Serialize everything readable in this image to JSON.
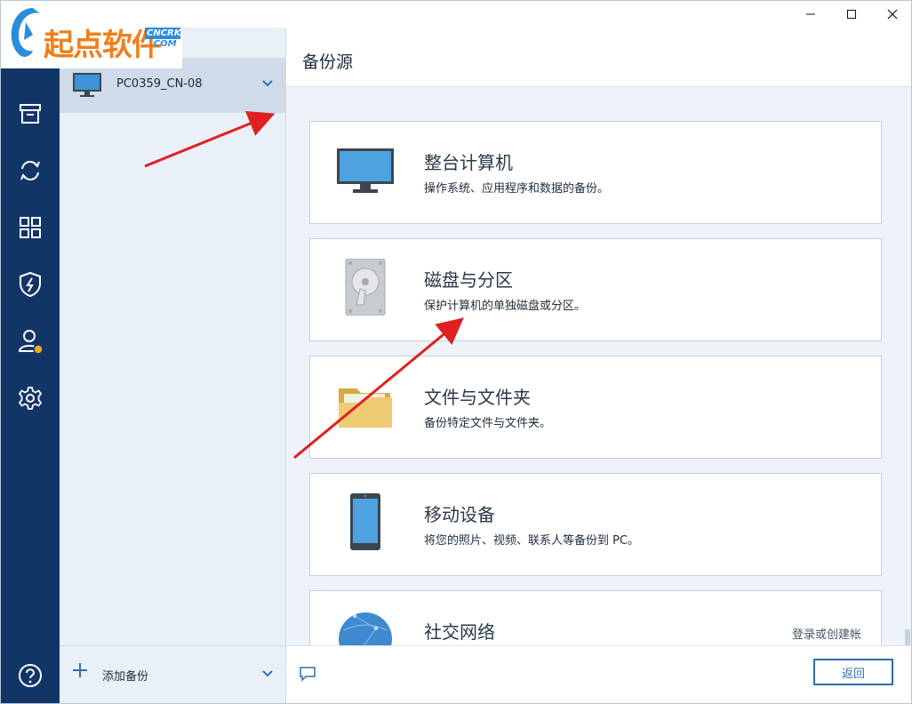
{
  "watermark": {
    "main_text": "起点软件",
    "tag_top": "CNCRK",
    "tag_bottom": ".COM"
  },
  "window_controls": [
    "minimize",
    "maximize",
    "close"
  ],
  "nav": {
    "icons": [
      "archive-icon",
      "sync-icon",
      "dashboard-icon",
      "shield-icon",
      "account-icon",
      "settings-icon",
      "help-icon"
    ],
    "notification_color": "#f6a623"
  },
  "backups": {
    "selected": {
      "name": "PC0359_CN-08"
    },
    "add_label": "添加备份"
  },
  "main": {
    "title": "备份源",
    "sources": [
      {
        "title": "整台计算机",
        "desc": "操作系统、应用程序和数据的备份。",
        "icon": "monitor-icon"
      },
      {
        "title": "磁盘与分区",
        "desc": "保护计算机的单独磁盘或分区。",
        "icon": "hard-disk-icon"
      },
      {
        "title": "文件与文件夹",
        "desc": "备份特定文件与文件夹。",
        "icon": "folder-icon"
      },
      {
        "title": "移动设备",
        "desc": "将您的照片、视频、联系人等备份到 PC。",
        "icon": "phone-icon"
      },
      {
        "title": "社交网络",
        "desc": "",
        "icon": "globe-icon",
        "action": "登录或创建帐"
      }
    ],
    "back_label": "返回"
  },
  "colors": {
    "nav_bg": "#123568",
    "accent": "#2e6db3",
    "arrow": "#e02020"
  }
}
